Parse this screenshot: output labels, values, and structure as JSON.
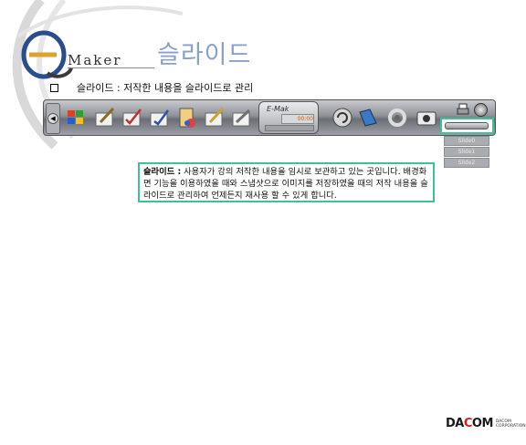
{
  "header": {
    "brand_word": "Maker",
    "title": "슬라이드"
  },
  "bullet": {
    "text": "슬라이드 : 저작한 내용을 슬라이드로 관리"
  },
  "toolbar": {
    "display": {
      "logo": "E-Mak",
      "counter": "00:00"
    },
    "slide_list": [
      "Slide0",
      "Slide1",
      "Slide2"
    ]
  },
  "description": {
    "term": "슬라이드 :",
    "body": " 사용자가 강의 저작한 내용을 임시로 보관하고 있는 곳입니다. 배경화면 기능을 이용하였을 때와 스냅샷으로 이미지를 저장하였을 때의 저작 내용을 슬라이드로 관리하여 언제든지 재사용 할 수 있게 합니다."
  },
  "footer": {
    "company_prefix": "DA",
    "company_ring": "C",
    "company_suffix": "OM",
    "corp_line1": "DACOM",
    "corp_line2": "CORPORATION"
  },
  "colors": {
    "highlight_border": "#3fbf9b",
    "title": "#8aa0c8"
  }
}
